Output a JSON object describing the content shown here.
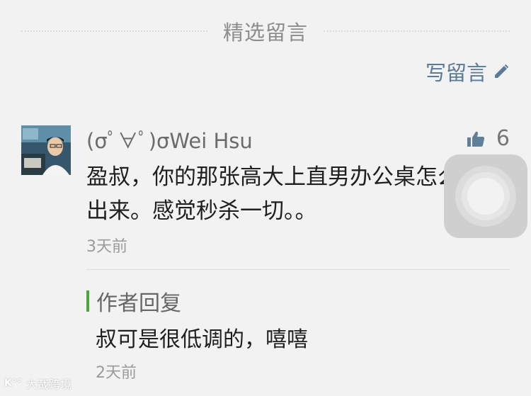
{
  "section": {
    "title": "精选留言"
  },
  "write_comment": {
    "label": "写留言",
    "icon": "pencil-icon",
    "color": "#5b7a96"
  },
  "comment": {
    "avatar_icon": "user-avatar",
    "name": "(σﾟ∀ﾟ)σWei Hsu",
    "like_icon": "thumbs-up-icon",
    "like_count": "6",
    "text": "盈叔，你的那张高大上直男办公桌怎么没放出来。感觉秒杀一切。。",
    "time": "3天前"
  },
  "reply": {
    "label": "作者回复",
    "accent_color": "#4aa83a",
    "text": "叔可是很低调的，嘻嘻",
    "time": "2天前"
  },
  "watermark": {
    "mark": "K°°",
    "text": "大哉跨境"
  }
}
